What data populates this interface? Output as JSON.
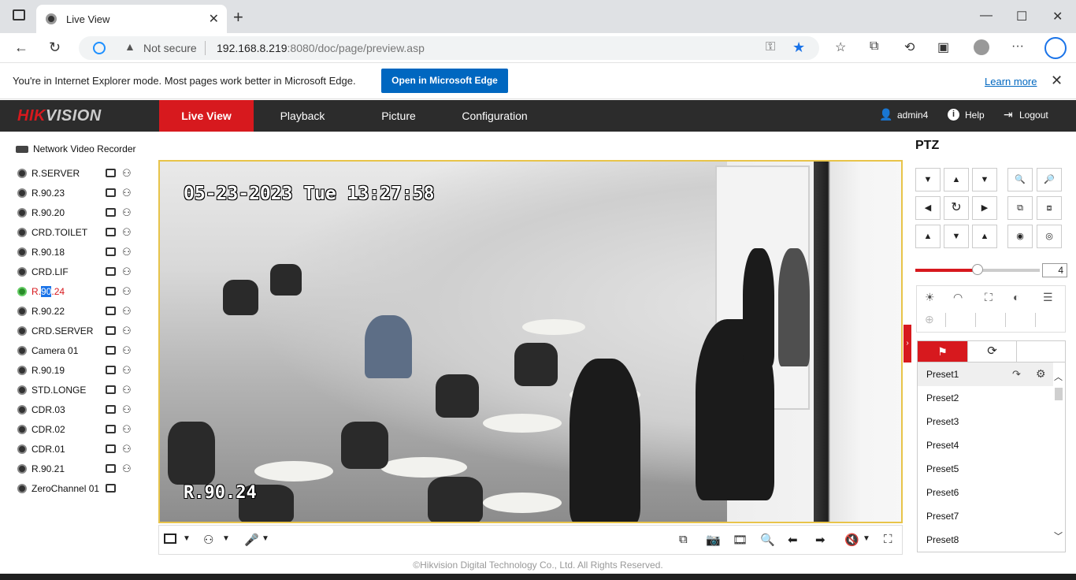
{
  "browser": {
    "tab_title": "Live View",
    "tab_close": "✕",
    "new_tab": "+",
    "win_min": "—",
    "win_max": "☐",
    "win_close": "✕",
    "back": "←",
    "reload": "↻",
    "security_icon": "▲",
    "security_text": "Not secure",
    "url_host": "192.168.8.219",
    "url_rest": ":8080/doc/page/preview.asp",
    "key_icon": "⚿",
    "star_icon": "★",
    "menu_icon": "···"
  },
  "ie_banner": {
    "message": "You're in Internet Explorer mode. Most pages work better in Microsoft Edge.",
    "open_button": "Open in Microsoft Edge",
    "learn_more": "Learn more",
    "close": "✕"
  },
  "app": {
    "logo_red": "HIK",
    "logo_white": "VISION",
    "nav": [
      "Live View",
      "Playback",
      "Picture",
      "Configuration"
    ],
    "user": "admin4",
    "help": "Help",
    "logout": "Logout"
  },
  "tree": {
    "root": "Network Video Recorder",
    "cameras": [
      {
        "name": "R.SERVER",
        "selected": false
      },
      {
        "name": "R.90.23",
        "selected": false
      },
      {
        "name": "R.90.20",
        "selected": false
      },
      {
        "name": "CRD.TOILET",
        "selected": false
      },
      {
        "name": "R.90.18",
        "selected": false
      },
      {
        "name": "CRD.LIF",
        "selected": false
      },
      {
        "name": "R.90.24",
        "selected": true
      },
      {
        "name": "R.90.22",
        "selected": false
      },
      {
        "name": "CRD.SERVER",
        "selected": false
      },
      {
        "name": "Camera 01",
        "selected": false
      },
      {
        "name": "R.90.19",
        "selected": false
      },
      {
        "name": "STD.LONGE",
        "selected": false
      },
      {
        "name": "CDR.03",
        "selected": false
      },
      {
        "name": "CDR.02",
        "selected": false
      },
      {
        "name": "CDR.01",
        "selected": false
      },
      {
        "name": "R.90.21",
        "selected": false
      },
      {
        "name": "ZeroChannel 01",
        "selected": false
      }
    ],
    "selected_parts": [
      "R.",
      "90",
      ".24"
    ]
  },
  "video": {
    "timestamp": "05-23-2023 Tue 13:27:58",
    "channel_label": "R.90.24"
  },
  "ptz": {
    "title": "PTZ",
    "speed": "4",
    "speed_fraction": 0.5,
    "presets": [
      "Preset1",
      "Preset2",
      "Preset3",
      "Preset4",
      "Preset5",
      "Preset6",
      "Preset7",
      "Preset8"
    ]
  },
  "footer": "©Hikvision Digital Technology Co., Ltd. All Rights Reserved.",
  "colors": {
    "accent": "#d7191e",
    "header_bg": "#2c2c2c",
    "edge_blue": "#0067c0",
    "video_border": "#e8c44a"
  }
}
